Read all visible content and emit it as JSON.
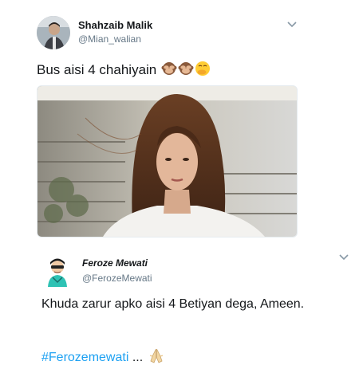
{
  "tweet": {
    "author_name": "Shahzaib Malik",
    "author_handle": "@Mian_walian",
    "text": "Bus aisi 4 chahiyain",
    "emojis": [
      "see-no-evil-monkey",
      "see-no-evil-monkey",
      "face-with-hand-over-mouth"
    ]
  },
  "reply": {
    "author_name": "Feroze Mewati",
    "author_handle": "@FerozeMewati",
    "text": "Khuda zarur apko aisi  4  Betiyan dega, Ameen.",
    "hashtag": "#Ferozemewati",
    "ellipsis": " ...",
    "emoji": "folded-hands"
  },
  "colors": {
    "link": "#1da1f2",
    "secondary_text": "#657786",
    "primary_text": "#14171a",
    "chevron": "#8899a6"
  }
}
